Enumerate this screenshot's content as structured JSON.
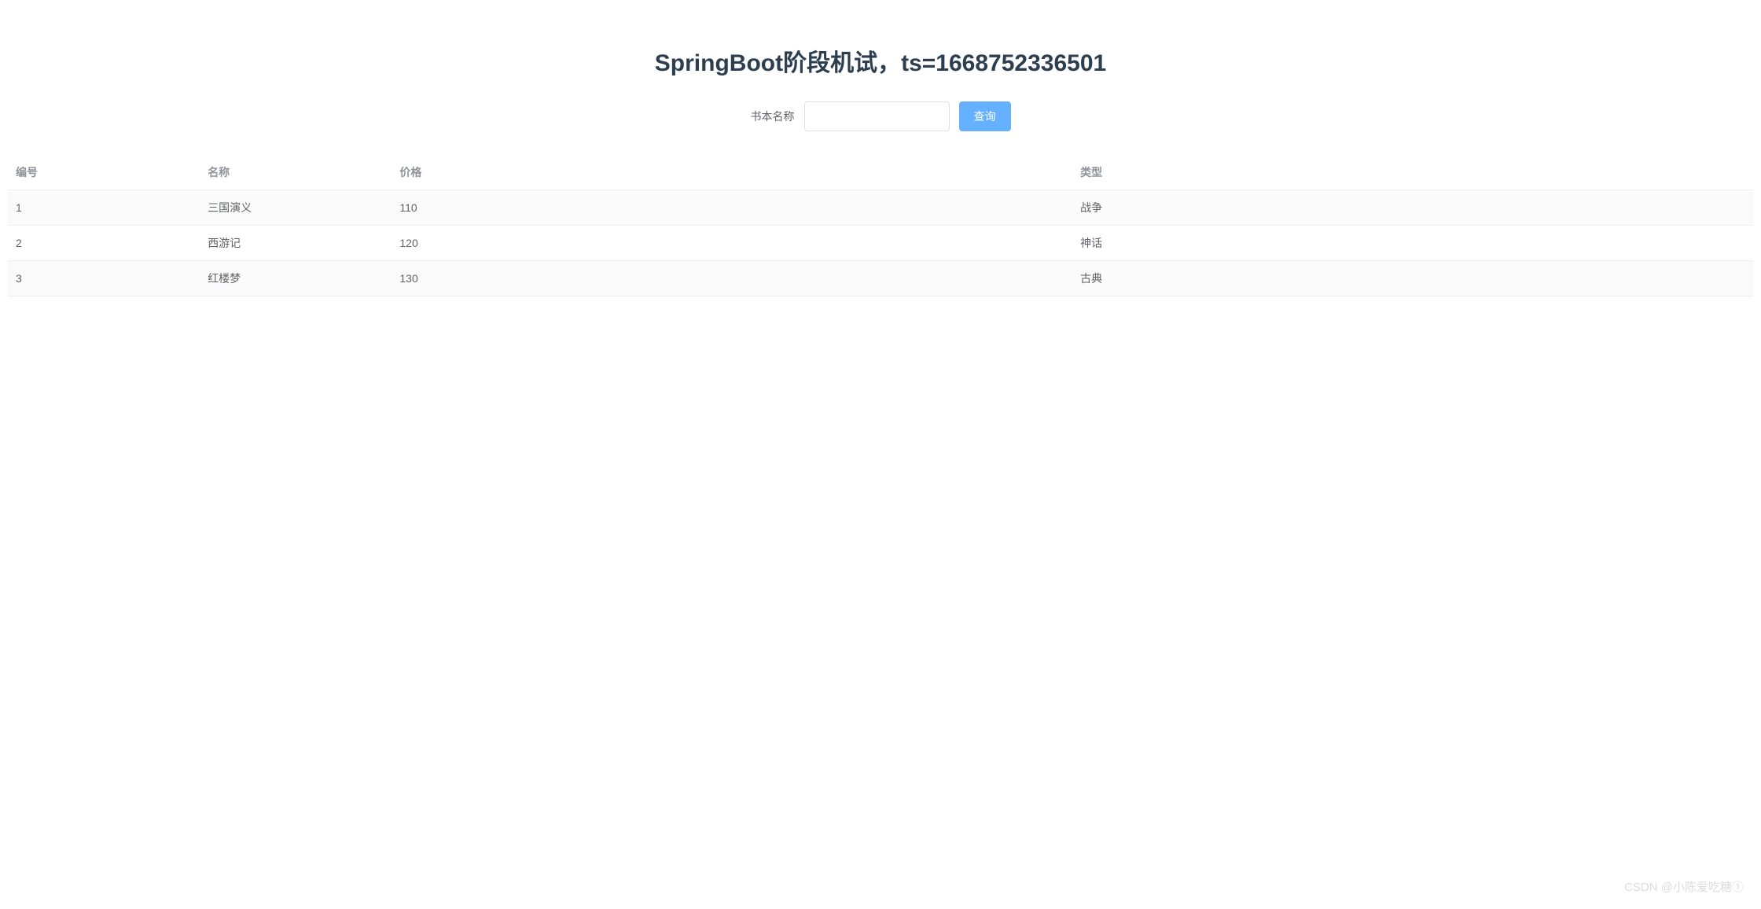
{
  "header": {
    "title": "SpringBoot阶段机试，ts=1668752336501"
  },
  "search": {
    "label": "书本名称",
    "input_value": "",
    "button_label": "查询"
  },
  "table": {
    "columns": {
      "id": "编号",
      "name": "名称",
      "price": "价格",
      "type": "类型"
    },
    "rows": [
      {
        "id": "1",
        "name": "三国演义",
        "price": "110",
        "type": "战争"
      },
      {
        "id": "2",
        "name": "西游记",
        "price": "120",
        "type": "神话"
      },
      {
        "id": "3",
        "name": "红楼梦",
        "price": "130",
        "type": "古典"
      }
    ]
  },
  "watermark": "CSDN @小陈爱吃糖①"
}
